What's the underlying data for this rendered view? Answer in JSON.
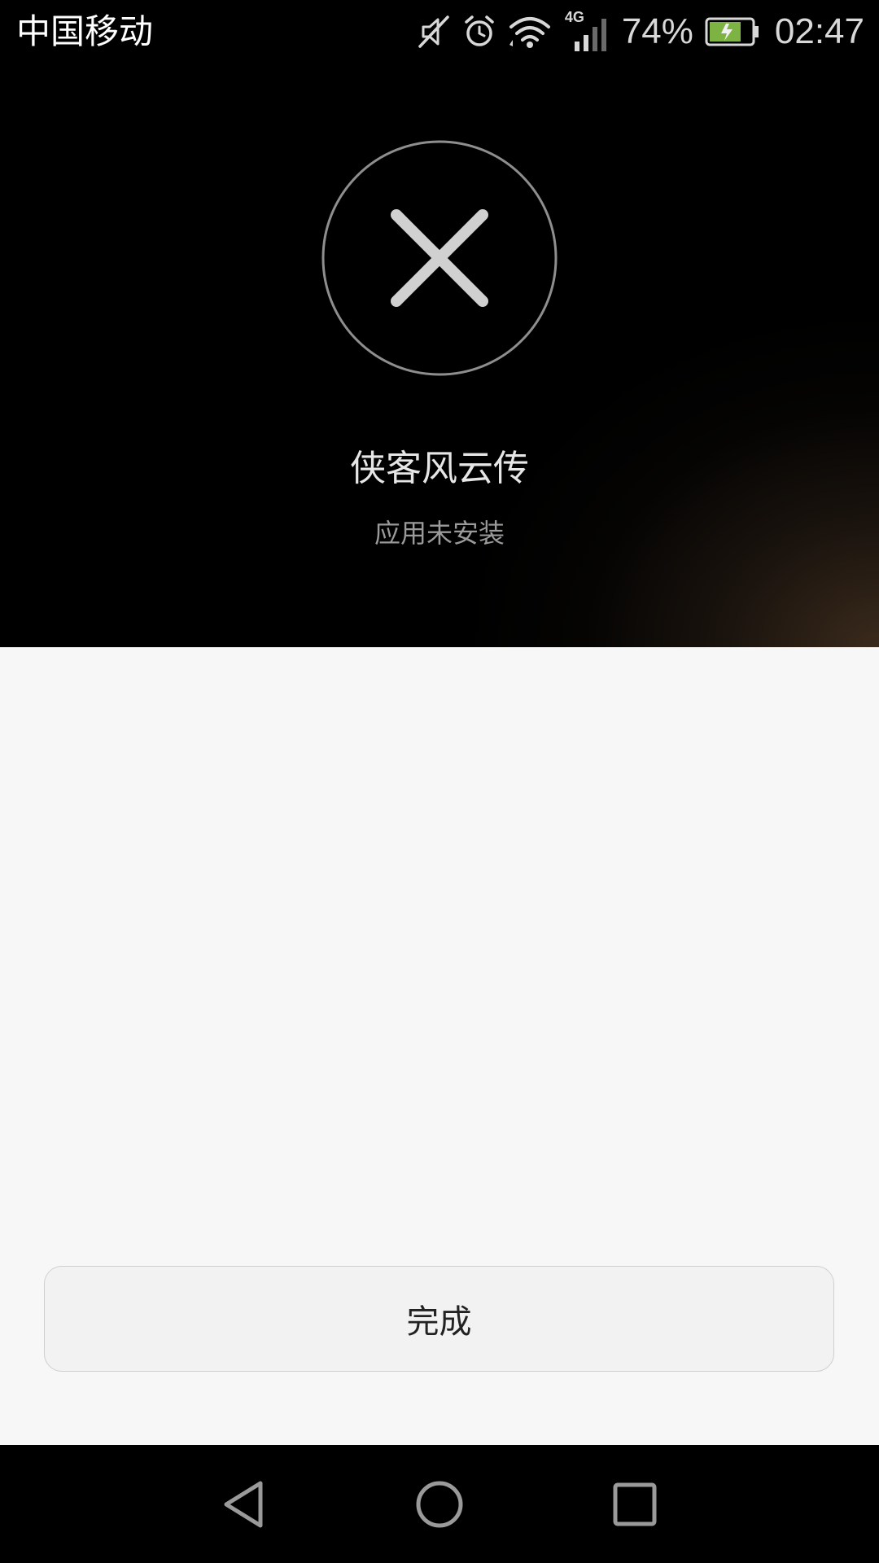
{
  "status_bar": {
    "carrier": "中国移动",
    "network_type": "4G",
    "battery_percent": "74%",
    "time": "02:47",
    "icons": [
      "mute-icon",
      "alarm-icon",
      "wifi-icon",
      "signal-icon",
      "battery-charging-icon"
    ]
  },
  "result": {
    "icon": "close-icon",
    "app_name": "侠客风云传",
    "message": "应用未安装"
  },
  "actions": {
    "done_label": "完成"
  },
  "nav": {
    "icons": [
      "back-icon",
      "home-icon",
      "recents-icon"
    ]
  },
  "colors": {
    "battery_fill": "#7cb342",
    "content_bg": "#f7f7f7"
  }
}
